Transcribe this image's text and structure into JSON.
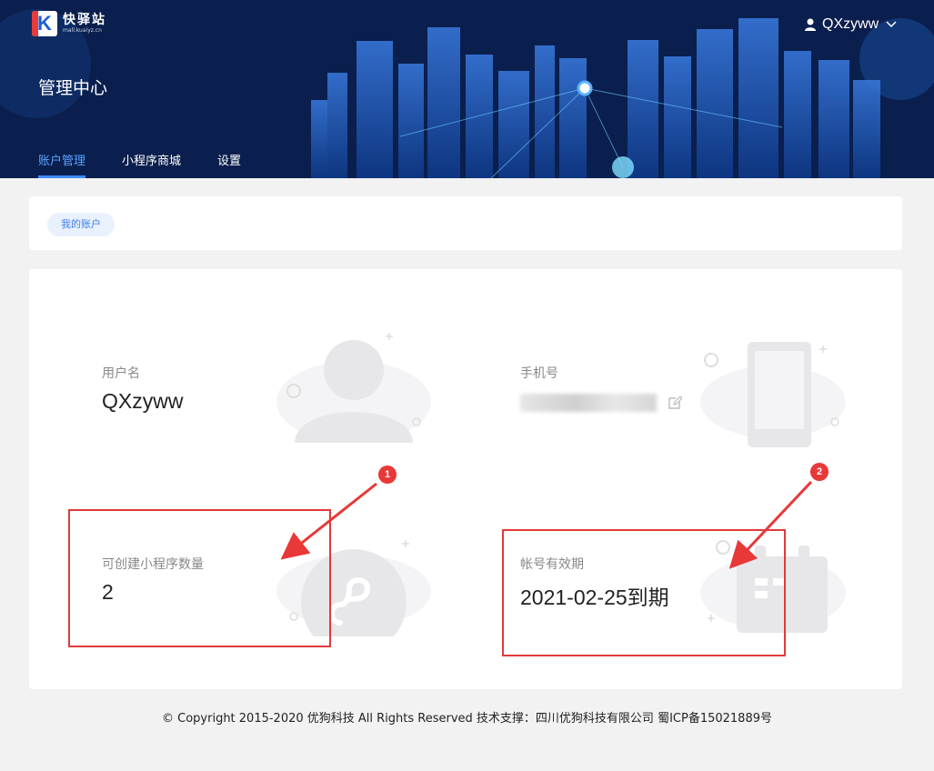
{
  "app": {
    "logo_title": "快驿站",
    "logo_subtitle": "mall.kuaiyz.cn",
    "logo_letter": "K",
    "page_title": "管理中心"
  },
  "user_menu": {
    "username": "QXzyww",
    "icons": {
      "user": "user-icon",
      "dropdown": "chevron-down-icon"
    }
  },
  "nav": {
    "items": [
      {
        "label": "账户管理",
        "active": true
      },
      {
        "label": "小程序商城",
        "active": false
      },
      {
        "label": "设置",
        "active": false
      }
    ]
  },
  "tabs": {
    "my_account": "我的账户"
  },
  "account": {
    "username_label": "用户名",
    "username_value": "QXzyww",
    "phone_label": "手机号",
    "phone_value": "",
    "mini_program_label": "可创建小程序数量",
    "mini_program_value": "2",
    "expiry_label": "帐号有效期",
    "expiry_value": "2021-02-25到期"
  },
  "annotations": {
    "badge_1": "1",
    "badge_2": "2",
    "color": "#e23a3a"
  },
  "footer": {
    "text": "© Copyright 2015-2020 优狗科技 All Rights Reserved 技术支撑：四川优狗科技有限公司 蜀ICP备15021889号"
  },
  "colors": {
    "header_bg": "#0a1f4d",
    "accent": "#3e8cff",
    "page_bg": "#f2f2f2"
  }
}
